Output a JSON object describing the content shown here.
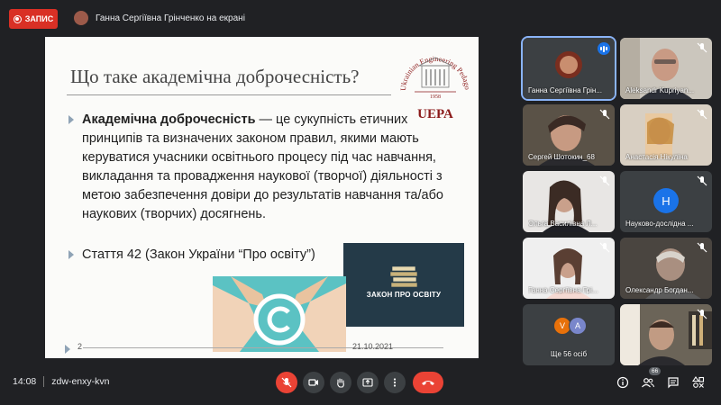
{
  "recording": {
    "label": "ЗАПИС"
  },
  "presenter": {
    "text": "Ганна Сергіївна Грінченко на екрані"
  },
  "slide": {
    "title": "Що таке академічна доброчесність?",
    "bullet1_term": "Академічна доброчесність",
    "bullet1_rest": " — це сукупність етичних принципів та визначених законом правил, якими мають керуватися учасники освітнього процесу під час навчання, викладання та провадження наукової (творчої) діяльності з метою забезпечення довіри до результатів навчання та/або наукових (творчих) досягнень.",
    "bullet2": "Стаття 42 (Закон України “Про освіту”)",
    "law_label": "ЗАКОН ПРО ОСВІТУ",
    "logo_arc_text": "Ukrainian Engineering Pedagogics Academy",
    "logo_year": "1958",
    "logo_abbr": "UEPA",
    "page_number": "2",
    "date": "21.10.2021"
  },
  "participants": [
    {
      "name": "Ганна Сергіївна Грін...",
      "active": true
    },
    {
      "name": "Aleksandr Kupriyan..."
    },
    {
      "name": "Сергей Шотокин_68"
    },
    {
      "name": "Анастасія Нікуліна"
    },
    {
      "name": "Ольга Василівна Л..."
    },
    {
      "name": "Науково-дослідна ...",
      "avatar_letter": "Н",
      "avatar_color": "#1a73e8"
    },
    {
      "name": "Ганна Сергіївна Грі..."
    },
    {
      "name": "Олександр Богдан..."
    },
    {
      "name": "Ще 56 осіб",
      "avatar_letters": [
        "V",
        "A"
      ],
      "avatar_colors": [
        "#e8710a",
        "#7986cb"
      ]
    },
    {
      "name": ""
    }
  ],
  "meeting": {
    "time": "14:08",
    "code": "zdw-enxy-kvn",
    "participant_count": "66"
  },
  "colors": {
    "background": "#202124",
    "tile": "#3c4043",
    "danger": "#ea4335",
    "accent": "#1a73e8"
  }
}
